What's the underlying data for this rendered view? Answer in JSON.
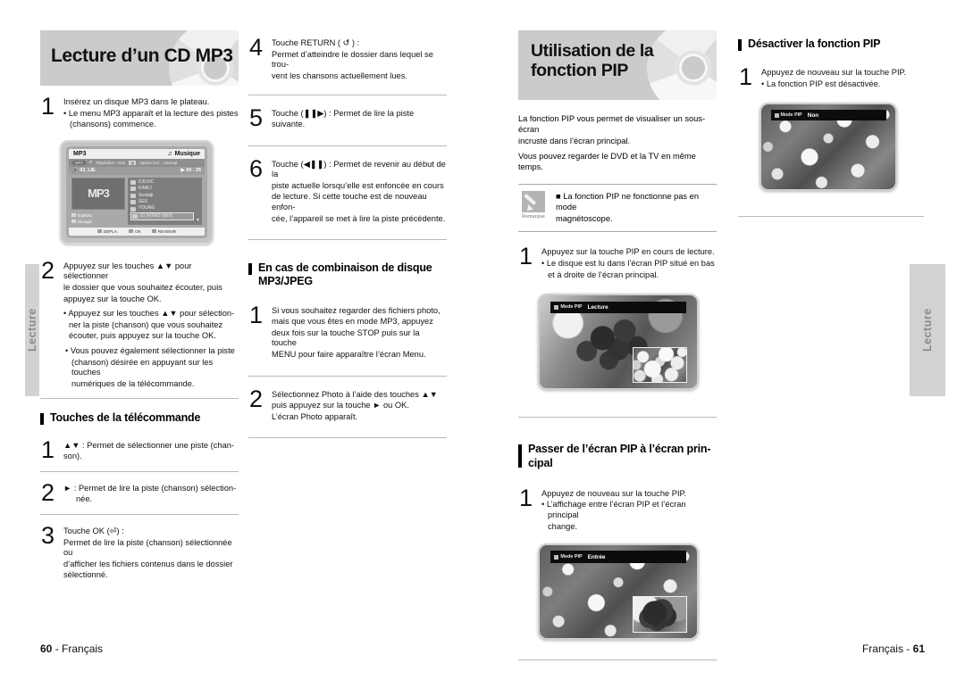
{
  "side_tabs": {
    "left": "Lecture",
    "right": "Lecture"
  },
  "footer": {
    "left_page": "60",
    "left_lang": "Français",
    "right_lang": "Français",
    "right_page": "61"
  },
  "left_page": {
    "banner_title": "Lecture d’un CD MP3",
    "steps_col1": [
      {
        "num": "1",
        "lines": [
          {
            "text": "Insérez un disque MP3 dans le plateau.",
            "style": "plain"
          },
          {
            "text": "• Le menu MP3 apparaît et la lecture des pistes",
            "style": "bullet"
          },
          {
            "text": "(chansons) commence.",
            "style": "cont"
          }
        ]
      },
      {
        "num": "2",
        "lines": [
          {
            "text": "Appuyez sur les touches ▲▼ pour sélectionner",
            "style": "plain"
          },
          {
            "text": "le dossier que vous souhaitez écouter, puis",
            "style": "plain"
          },
          {
            "text": "appuyez sur la touche OK.",
            "style": "plain"
          },
          {
            "text": "• Appuyez sur les touches ▲▼ pour sélection-",
            "style": "bullet"
          },
          {
            "text": "ner la piste (chanson) que vous souhaitez",
            "style": "cont"
          },
          {
            "text": "écouter, puis appuyez sur la touche OK.",
            "style": "cont"
          },
          {
            "text": "• Vous pouvez également sélectionner la piste",
            "style": "bullet"
          },
          {
            "text": "(chanson) désirée en appuyant sur les touches",
            "style": "cont"
          },
          {
            "text": "numériques de la télécommande.",
            "style": "cont"
          }
        ]
      }
    ],
    "remote_section": {
      "heading": "Touches de la télécommande",
      "steps": [
        {
          "num": "1",
          "lines": [
            {
              "text": "▲▼ : Permet de sélectionner une piste (chan-",
              "style": "plain"
            },
            {
              "text": "son).",
              "style": "plain"
            }
          ]
        },
        {
          "num": "2",
          "lines": [
            {
              "text": "► : Permet de lire la piste (chanson) sélection-",
              "style": "plain"
            },
            {
              "text": "née.",
              "style": "indent"
            }
          ]
        },
        {
          "num": "3",
          "lines": [
            {
              "text": "Touche OK (⏎) :",
              "style": "plain"
            },
            {
              "text": "Permet de lire la piste (chanson) sélectionnée ou",
              "style": "plain"
            },
            {
              "text": "d’afficher les fichiers contenus dans le dossier",
              "style": "plain"
            },
            {
              "text": "sélectionné.",
              "style": "plain"
            }
          ]
        }
      ]
    },
    "steps_col2": [
      {
        "num": "4",
        "lines": [
          {
            "text": "Touche RETURN ( ↺ ) :",
            "style": "plain"
          },
          {
            "text": "Permet d’atteindre le dossier dans lequel se trou-",
            "style": "plain"
          },
          {
            "text": "vent les chansons actuellement lues.",
            "style": "plain"
          }
        ]
      },
      {
        "num": "5",
        "lines": [
          {
            "text": "Touche (❚❚▶) : Permet de lire la piste suivante.",
            "style": "plain"
          }
        ]
      },
      {
        "num": "6",
        "lines": [
          {
            "text": "Touche (◀❚❚) : Permet de revenir au début de la",
            "style": "plain"
          },
          {
            "text": "piste actuelle lorsqu’elle est enfoncée en cours",
            "style": "plain"
          },
          {
            "text": "de lecture. Si cette touche est de nouveau enfon-",
            "style": "plain"
          },
          {
            "text": "cée, l’appareil se met à lire la piste précédente.",
            "style": "plain"
          }
        ]
      }
    ],
    "combo_section": {
      "heading_line1": "En cas de combinaison de disque",
      "heading_line2": "MP3/JPEG",
      "steps": [
        {
          "num": "1",
          "lines": [
            {
              "text": "Si vous souhaitez regarder des fichiers photo,",
              "style": "plain"
            },
            {
              "text": "mais que vous êtes en mode MP3, appuyez",
              "style": "plain"
            },
            {
              "text": "deux fois sur la touche STOP puis sur la touche",
              "style": "plain"
            },
            {
              "text": "MENU pour faire apparaître l’écran Menu.",
              "style": "plain"
            }
          ]
        },
        {
          "num": "2",
          "lines": [
            {
              "text": "Sélectionnez Photo à l’aide des touches ▲▼",
              "style": "plain"
            },
            {
              "text": "puis appuyez sur la touche  ► ou OK.",
              "style": "plain"
            },
            {
              "text": "L’écran Photo apparaît.",
              "style": "plain"
            }
          ]
        }
      ]
    },
    "osd": {
      "title": "MP3",
      "mode": "Musique",
      "mode_icon": "note-icon",
      "repeat_label": "Répétition : Non",
      "play_option_label": "Option lect. : Normal",
      "pill": "MP3",
      "track": "03_LIE",
      "time": "00 : 25",
      "logo": "MP3",
      "left_meta": [
        "DJDOC",
        "03.mp3"
      ],
      "items": [
        {
          "label": "DJDOC",
          "selected": false
        },
        {
          "label": "KIMKJ",
          "selected": false
        },
        {
          "label": "Seotaiji",
          "selected": false
        },
        {
          "label": "SES",
          "selected": false
        },
        {
          "label": "YOUNG",
          "selected": false
        },
        {
          "label": "01 INTRO (MIX)",
          "selected": true
        }
      ],
      "scroll_icon": "▼",
      "bottom": [
        "DÉPLA.",
        "OK",
        "REVENIR"
      ]
    }
  },
  "right_page": {
    "banner_title_line1": "Utilisation de la",
    "banner_title_line2": "fonction PIP",
    "intro_line1": "La fonction PIP vous permet de visualiser un sous-écran",
    "intro_line2": "incrusté dans l’écran principal.",
    "intro_line3": "Vous pouvez regarder le DVD et la TV en même temps.",
    "note": {
      "tag": "Remarque",
      "icon": "pencil-icon",
      "line1": "■ La fonction PIP ne fonctionne pas en mode",
      "line2": "magnétoscope."
    },
    "step1": {
      "num": "1",
      "lines": [
        {
          "text": "Appuyez sur la touche PIP en cours de lecture.",
          "style": "plain"
        },
        {
          "text": "• Le disque est lu dans l’écran PIP situé en bas",
          "style": "bullet"
        },
        {
          "text": "et à droite de l’écran principal.",
          "style": "cont"
        }
      ]
    },
    "tv_playing": {
      "mode_label": "Mode PIP",
      "value": "Lecture"
    },
    "swap_section": {
      "heading_line1": "Passer de l’écran PIP à l’écran prin-",
      "heading_line2": "cipal",
      "step": {
        "num": "1",
        "lines": [
          {
            "text": "Appuyez de nouveau sur la touche PIP.",
            "style": "plain"
          },
          {
            "text": "• L’affichage entre l’écran PIP et l’écran principal",
            "style": "bullet"
          },
          {
            "text": "change.",
            "style": "cont"
          }
        ]
      },
      "tv": {
        "mode_label": "Mode PIP",
        "value": "Entrée"
      }
    },
    "disable_section": {
      "heading": "Désactiver la fonction PIP",
      "step": {
        "num": "1",
        "lines": [
          {
            "text": "Appuyez de nouveau sur la touche PIP.",
            "style": "plain"
          },
          {
            "text": "• La fonction PIP est désactivée.",
            "style": "bullet"
          }
        ]
      },
      "tv": {
        "mode_label": "Mode PIP",
        "value": "Non"
      }
    }
  }
}
